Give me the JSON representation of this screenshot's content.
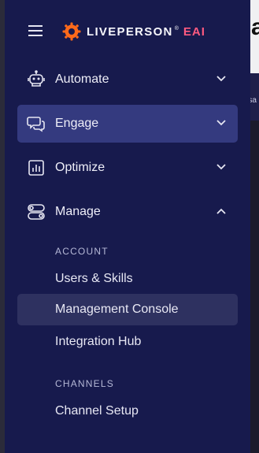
{
  "brand": {
    "name": "LIVEPERSON",
    "registered": "®",
    "suffix": "EAI",
    "accent_color": "#ff5a80",
    "logo_color": "#ff6a1a"
  },
  "background": {
    "heading_fragment": "a",
    "band_fragment": "rsa"
  },
  "nav": {
    "items": [
      {
        "label": "Automate",
        "icon": "robot-icon",
        "chevron": "chevron-down-icon"
      },
      {
        "label": "Engage",
        "icon": "chat-bubbles-icon",
        "chevron": "chevron-down-icon",
        "active": true
      },
      {
        "label": "Optimize",
        "icon": "bar-chart-icon",
        "chevron": "chevron-down-icon"
      },
      {
        "label": "Manage",
        "icon": "toggles-icon",
        "chevron": "chevron-up-icon",
        "expanded": true
      }
    ],
    "manage": {
      "sections": [
        {
          "title": "ACCOUNT",
          "items": [
            "Users & Skills",
            "Management Console",
            "Integration Hub"
          ]
        },
        {
          "title": "CHANNELS",
          "items": [
            "Channel Setup"
          ]
        }
      ],
      "active_item": "Management Console"
    }
  },
  "colors": {
    "sidebar_bg": "#171a4d",
    "active_bg": "#343a7f",
    "sub_active_bg": "#2e3160"
  }
}
